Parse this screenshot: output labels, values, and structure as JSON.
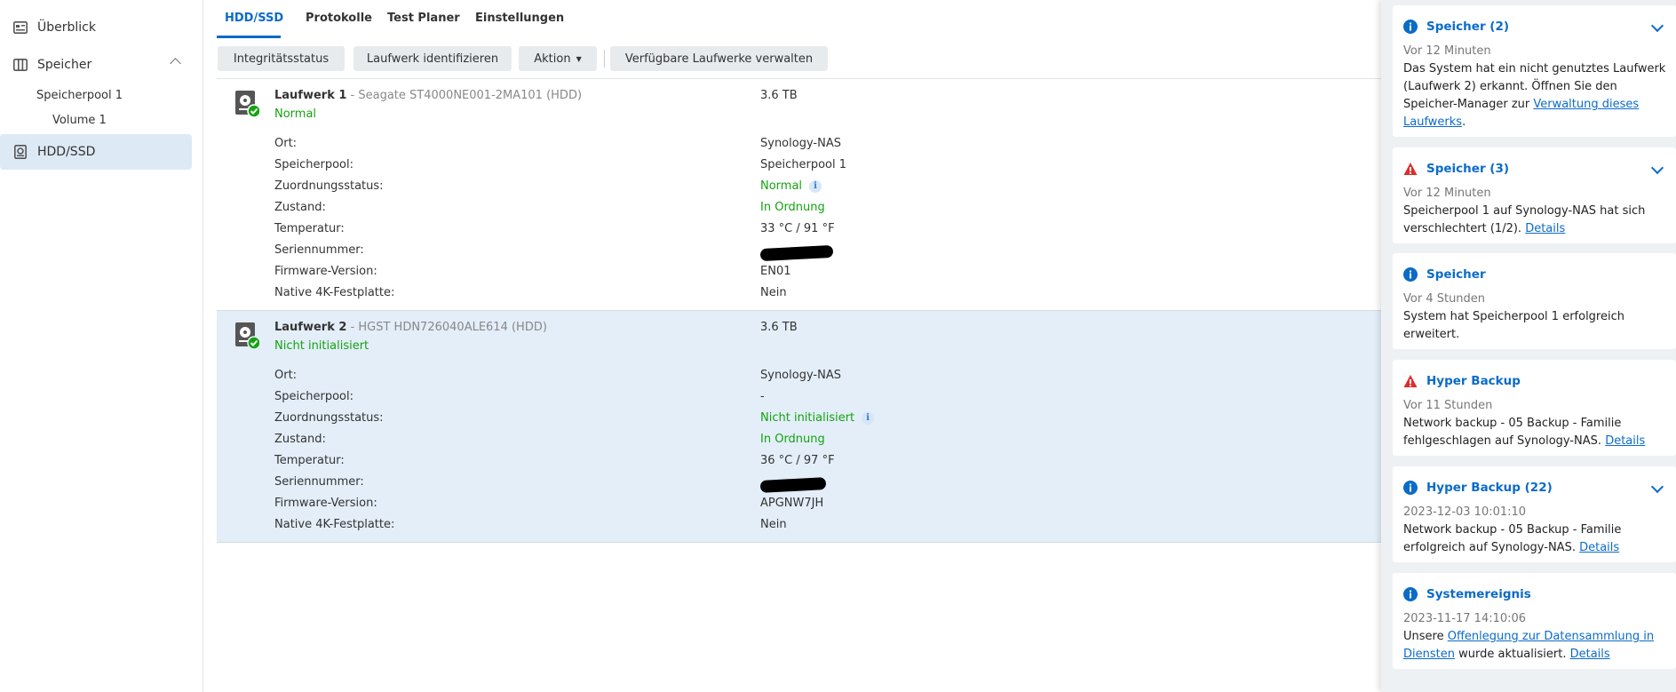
{
  "sidebar": {
    "overview": "Überblick",
    "storage": "Speicher",
    "pool": "Speicherpool 1",
    "volume": "Volume 1",
    "hdd": "HDD/SSD"
  },
  "tabs": [
    "HDD/SSD",
    "Protokolle",
    "Test Planer",
    "Einstellungen"
  ],
  "toolbar": {
    "integrity": "Integritätsstatus",
    "identify": "Laufwerk identifizieren",
    "action": "Aktion",
    "manage": "Verfügbare Laufwerke verwalten"
  },
  "labels": {
    "ort": "Ort:",
    "pool": "Speicherpool:",
    "alloc": "Zuordnungsstatus:",
    "health": "Zustand:",
    "temp": "Temperatur:",
    "serial": "Seriennummer:",
    "firmware": "Firmware-Version:",
    "native4k": "Native 4K-Festplatte:"
  },
  "drives": [
    {
      "name": "Laufwerk 1",
      "model": " - Seagate ST4000NE001-2MA101 (HDD)",
      "status": "Normal",
      "size": "3.6 TB",
      "ort": "Synology-NAS",
      "pool": "Speicherpool 1",
      "alloc": "Normal",
      "health": "In Ordnung",
      "temp": "33 °C / 91 °F",
      "firmware": "EN01",
      "native4k": "Nein"
    },
    {
      "name": "Laufwerk 2",
      "model": " - HGST HDN726040ALE614 (HDD)",
      "status": "Nicht initialisiert",
      "size": "3.6 TB",
      "ort": "Synology-NAS",
      "pool": "-",
      "alloc": "Nicht initialisiert",
      "health": "In Ordnung",
      "temp": "36 °C / 97 °F",
      "firmware": "APGNW7JH",
      "native4k": "Nein"
    }
  ],
  "notifications": [
    {
      "title": "Speicher (2)",
      "type": "info",
      "time": "Vor 12 Minuten",
      "text": "Das System hat ein nicht genutztes Laufwerk (Laufwerk 2) erkannt. Öffnen Sie den Speicher-Manager zur ",
      "link": "Verwaltung dieses Laufwerks",
      "after": "."
    },
    {
      "title": "Speicher (3)",
      "type": "warning",
      "time": "Vor 12 Minuten",
      "text": "Speicherpool 1 auf Synology-NAS hat sich verschlechtert (1/2). ",
      "link": "Details",
      "after": ""
    },
    {
      "title": "Speicher",
      "type": "info",
      "time": "Vor 4 Stunden",
      "text": "System hat Speicherpool 1 erfolgreich erweitert.",
      "link": "",
      "after": ""
    },
    {
      "title": "Hyper Backup",
      "type": "warning",
      "time": "Vor 11 Stunden",
      "text": "Network backup - 05 Backup - Familie fehlgeschlagen auf Synology-NAS. ",
      "link": "Details",
      "after": ""
    },
    {
      "title": "Hyper Backup (22)",
      "type": "info",
      "time": "2023-12-03 10:01:10",
      "text": "Network backup - 05 Backup - Familie erfolgreich auf Synology-NAS. ",
      "link": "Details",
      "after": ""
    },
    {
      "title": "Systemereignis",
      "type": "info",
      "time": "2023-11-17 14:10:06",
      "text": "Unsere ",
      "link": "Offenlegung zur Datensammlung in Diensten",
      "after": " wurde aktualisiert. ",
      "link2": "Details"
    }
  ],
  "colors": {
    "accent": "#0b6bc9",
    "ok": "#14a30f",
    "warn": "#e02b2b"
  }
}
